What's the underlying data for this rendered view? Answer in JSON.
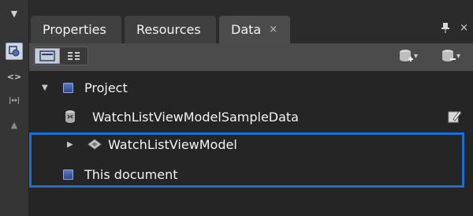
{
  "tabs": [
    {
      "label": "Properties"
    },
    {
      "label": "Resources"
    },
    {
      "label": "Data",
      "close": "×"
    }
  ],
  "window_buttons": {
    "pin": "📌",
    "close": "×"
  },
  "left_strip": {
    "top_arrow": "▼",
    "code_icon": "<>",
    "ruler_icon": "|↔|",
    "bottom_arrow": "▲"
  },
  "toolbar": {
    "dropdown_glyph": "▾"
  },
  "tree": {
    "project": "Project",
    "sample_data": "WatchListViewModelSampleData",
    "view_model": "WatchListViewModel",
    "this_document": "This document",
    "expanded_glyph": "▼",
    "collapsed_glyph": "▶"
  },
  "colors": {
    "highlight": "#1c6fd0",
    "tree_bg": "#252525",
    "panel_bg": "#4b4b4b"
  }
}
